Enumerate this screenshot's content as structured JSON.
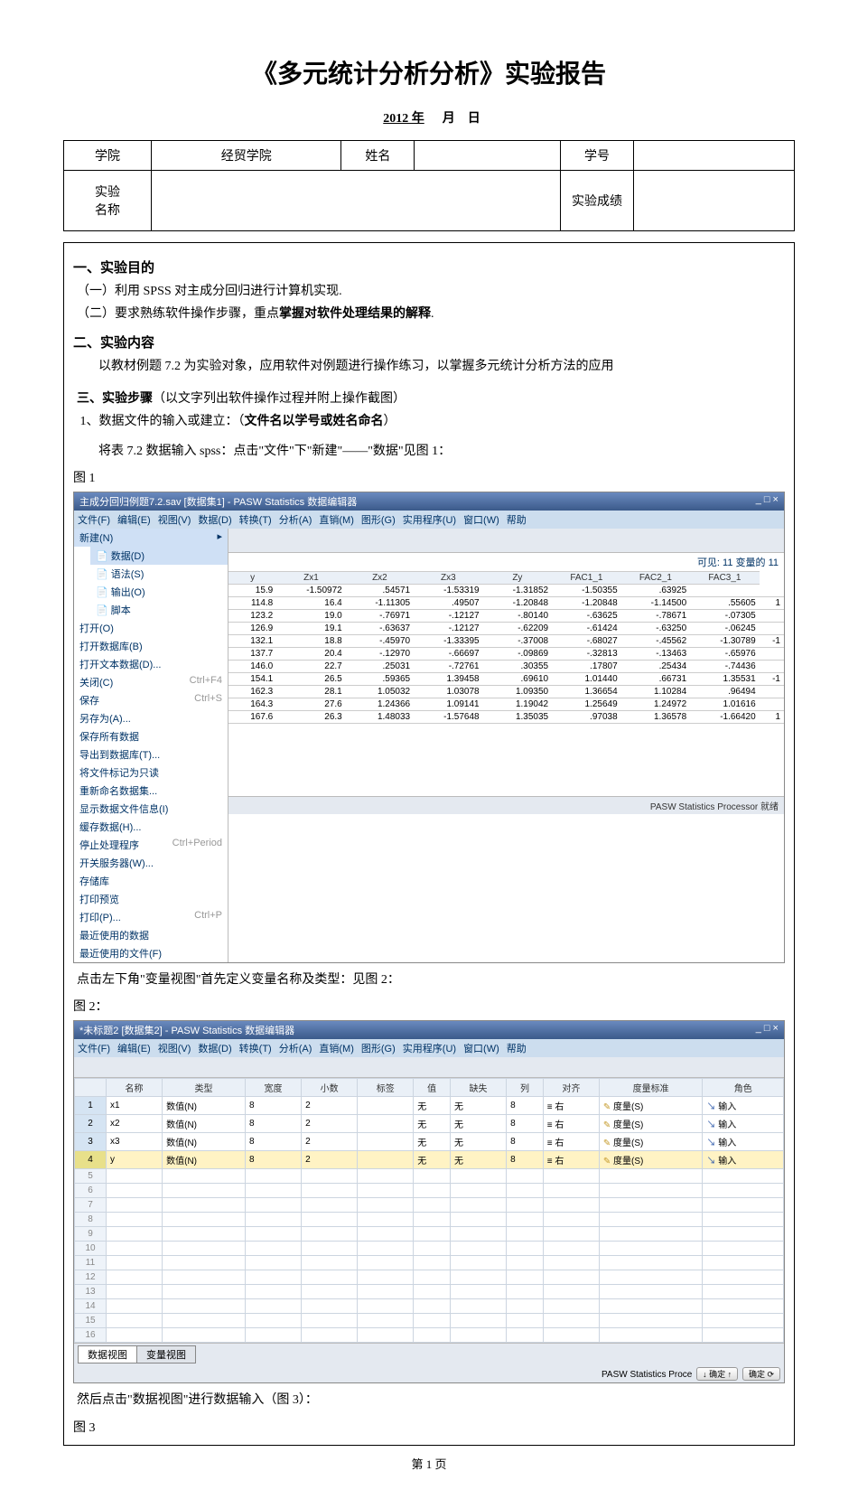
{
  "doc": {
    "title": "《多元统计分析分析》实验报告",
    "year_label": "2012 年",
    "month_label": "月",
    "day_label": "日",
    "footer_page": "第 1 页"
  },
  "form": {
    "college_h": "学院",
    "college_v": "经贸学院",
    "name_h": "姓名",
    "id_h": "学号",
    "exp_h": "实验\n名称",
    "grade_h": "实验成绩"
  },
  "sec1": {
    "title": "一、实验目的",
    "l1_pre": "（一）利用 SPSS 对主成分回归进行计算机实现.",
    "l2_pre": "（二）要求熟练软件操作步骤，重点",
    "l2_bold": "掌握对软件处理结果的解释",
    "l2_end": "."
  },
  "sec2": {
    "title": "二、实验内容",
    "l1": "以教材例题 7.2 为实验对象，应用软件对例题进行操作练习，以掌握多元统计分析方法的应用"
  },
  "sec3": {
    "title_pre": "三、实验步骤",
    "title_note": "（以文字列出软件操作过程并附上操作截图）",
    "l1_pre": "1、数据文件的输入或建立：（",
    "l1_bold": "文件名以学号或姓名命名",
    "l1_end": "）",
    "l2": "将表 7.2 数据输入 spss：点击\"文件\"下\"新建\"——\"数据\"见图 1："
  },
  "fig1": {
    "label": "图 1",
    "win_title": "主成分回归例题7.2.sav [数据集1] - PASW Statistics 数据编辑器",
    "win_btn": "_ □ ×",
    "menus": [
      "文件(F)",
      "编辑(E)",
      "视图(V)",
      "数据(D)",
      "转换(T)",
      "分析(A)",
      "直销(M)",
      "图形(G)",
      "实用程序(U)",
      "窗口(W)",
      "帮助"
    ],
    "file_menu": {
      "top": {
        "label": "新建(N)",
        "shortcut": ""
      },
      "sub_items": [
        {
          "label": "数据(D)",
          "hi": true
        },
        {
          "label": "语法(S)"
        },
        {
          "label": "输出(O)"
        },
        {
          "label": "脚本"
        }
      ],
      "rest": [
        {
          "label": "打开(O)",
          "shortcut": ""
        },
        {
          "label": "打开数据库(B)",
          "shortcut": ""
        },
        {
          "label": "打开文本数据(D)...",
          "shortcut": ""
        },
        {
          "label": "关闭(C)",
          "shortcut": "Ctrl+F4"
        },
        {
          "label": "保存",
          "shortcut": "Ctrl+S"
        },
        {
          "label": "另存为(A)...",
          "shortcut": ""
        },
        {
          "label": "保存所有数据",
          "shortcut": ""
        },
        {
          "label": "导出到数据库(T)...",
          "shortcut": ""
        },
        {
          "label": "将文件标记为只读",
          "shortcut": ""
        },
        {
          "label": "重新命名数据集...",
          "shortcut": ""
        },
        {
          "label": "显示数据文件信息(I)",
          "shortcut": ""
        },
        {
          "label": "缓存数据(H)...",
          "shortcut": ""
        },
        {
          "label": "停止处理程序",
          "shortcut": "Ctrl+Period"
        },
        {
          "label": "开关服务器(W)...",
          "shortcut": ""
        },
        {
          "label": "存储库",
          "shortcut": ""
        },
        {
          "label": "打印预览",
          "shortcut": ""
        },
        {
          "label": "打印(P)...",
          "shortcut": "Ctrl+P"
        },
        {
          "label": "最近使用的数据",
          "shortcut": ""
        },
        {
          "label": "最近使用的文件(F)",
          "shortcut": ""
        }
      ]
    },
    "hint": "可见: 11 变量的 11",
    "headers": [
      "y",
      "Zx1",
      "Zx2",
      "Zx3",
      "Zy",
      "FAC1_1",
      "FAC2_1",
      "FAC3_1"
    ],
    "rows": [
      [
        "15.9",
        "-1.50972",
        ".54571",
        "-1.53319",
        "-1.31852",
        "-1.50355",
        ".63925",
        ""
      ],
      [
        "114.8",
        "16.4",
        "-1.11305",
        ".49507",
        "-1.20848",
        "-1.20848",
        "-1.14500",
        ".55605",
        "1"
      ],
      [
        "123.2",
        "19.0",
        "-.76971",
        "-.12127",
        "-.80140",
        "-.63625",
        "-.78671",
        "-.07305",
        ""
      ],
      [
        "126.9",
        "19.1",
        "-.63637",
        "-.12127",
        "-.62209",
        "-.61424",
        "-.63250",
        "-.06245",
        ""
      ],
      [
        "132.1",
        "18.8",
        "-.45970",
        "-1.33395",
        "-.37008",
        "-.68027",
        "-.45562",
        "-1.30789",
        "-1"
      ],
      [
        "137.7",
        "20.4",
        "-.12970",
        "-.66697",
        "-.09869",
        "-.32813",
        "-.13463",
        "-.65976",
        ""
      ],
      [
        "146.0",
        "22.7",
        ".25031",
        "-.72761",
        ".30355",
        ".17807",
        ".25434",
        "-.74436",
        ""
      ],
      [
        "154.1",
        "26.5",
        ".59365",
        "1.39458",
        ".69610",
        "1.01440",
        ".66731",
        "1.35531",
        "-1"
      ],
      [
        "162.3",
        "28.1",
        "1.05032",
        "1.03078",
        "1.09350",
        "1.36654",
        "1.10284",
        ".96494",
        ""
      ],
      [
        "164.3",
        "27.6",
        "1.24366",
        "1.09141",
        "1.19042",
        "1.25649",
        "1.24972",
        "1.01616",
        ""
      ],
      [
        "167.6",
        "26.3",
        "1.48033",
        "-1.57648",
        "1.35035",
        ".97038",
        "1.36578",
        "-1.66420",
        "1"
      ]
    ],
    "status": "PASW Statistics Processor 就绪"
  },
  "mid": {
    "l1": "点击左下角\"变量视图\"首先定义变量名称及类型：见图 2：",
    "label": "图 2："
  },
  "fig2": {
    "win_title": "*未标题2 [数据集2] - PASW Statistics 数据编辑器",
    "win_btn": "_ □ ×",
    "menus": [
      "文件(F)",
      "编辑(E)",
      "视图(V)",
      "数据(D)",
      "转换(T)",
      "分析(A)",
      "直销(M)",
      "图形(G)",
      "实用程序(U)",
      "窗口(W)",
      "帮助"
    ],
    "headers": [
      "",
      "名称",
      "类型",
      "宽度",
      "小数",
      "标签",
      "值",
      "缺失",
      "列",
      "对齐",
      "度量标准",
      "角色"
    ],
    "rows": [
      {
        "n": "1",
        "sel": false,
        "cells": [
          "x1",
          "数值(N)",
          "8",
          "2",
          "",
          "无",
          "无",
          "8",
          "≡ 右",
          "度量(S)",
          "输入"
        ]
      },
      {
        "n": "2",
        "sel": false,
        "cells": [
          "x2",
          "数值(N)",
          "8",
          "2",
          "",
          "无",
          "无",
          "8",
          "≡ 右",
          "度量(S)",
          "输入"
        ]
      },
      {
        "n": "3",
        "sel": false,
        "cells": [
          "x3",
          "数值(N)",
          "8",
          "2",
          "",
          "无",
          "无",
          "8",
          "≡ 右",
          "度量(S)",
          "输入"
        ]
      },
      {
        "n": "4",
        "sel": true,
        "cells": [
          "y",
          "数值(N)",
          "8",
          "2",
          "",
          "无",
          "无",
          "8",
          "≡ 右",
          "度量(S)",
          "输入"
        ]
      }
    ],
    "empty_rows": [
      "5",
      "6",
      "7",
      "8",
      "9",
      "10",
      "11",
      "12",
      "13",
      "14",
      "15",
      "16"
    ],
    "tabs": {
      "data": "数据视图",
      "var": "变量视图"
    },
    "status_prefix": "PASW Statistics Proce",
    "status_btn1": "↓  确定  ↑",
    "status_btn2": "确定  ⟳"
  },
  "tail": {
    "l1": "然后点击\"数据视图\"进行数据输入（图 3）：",
    "label": "图 3"
  }
}
